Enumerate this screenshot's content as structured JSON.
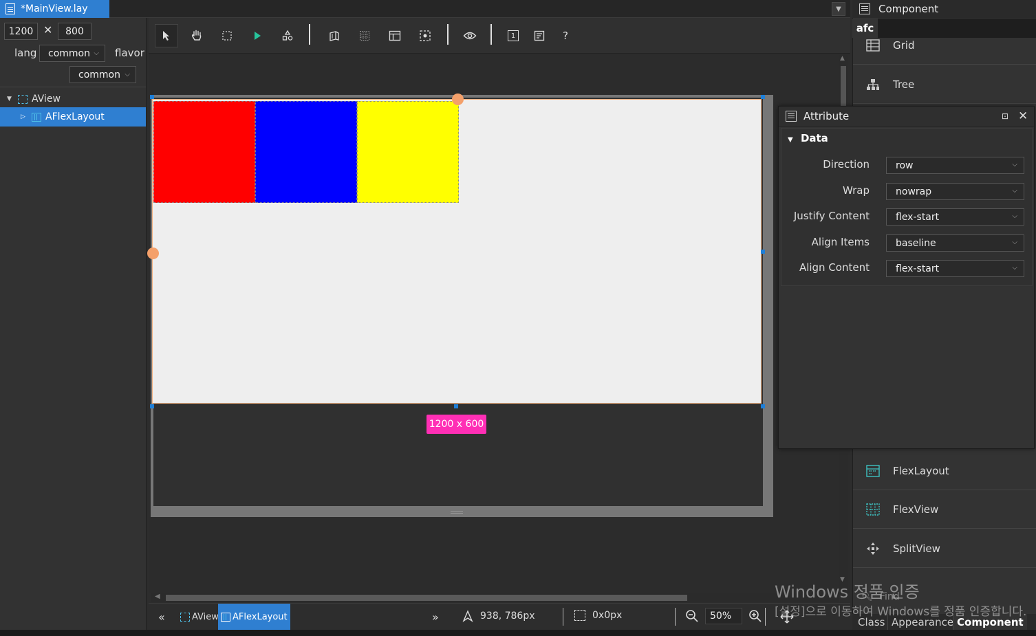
{
  "file_tab": {
    "title": "*MainView.lay"
  },
  "left_panel": {
    "width_value": "1200",
    "times_symbol": "✕",
    "height_value": "800",
    "lang_label": "lang",
    "lang_value": "common",
    "flavor_label": "flavor",
    "flavor_value": "common",
    "tree": [
      {
        "label": "AView",
        "expanded": true,
        "selected": false
      },
      {
        "label": "AFlexLayout",
        "expanded": false,
        "selected": true
      }
    ]
  },
  "toolbar": {
    "help_label": "?",
    "page_number": "1"
  },
  "canvas": {
    "boxes": [
      {
        "color": "#ff0000"
      },
      {
        "color": "#0000ff"
      },
      {
        "color": "#ffff00"
      }
    ],
    "size_badge": "1200 x 600",
    "badge_color": "#ff2fb5"
  },
  "statusbar": {
    "crumbs": [
      "AView",
      "AFlexLayout"
    ],
    "cursor_pos": "938, 786px",
    "selection_size": "0x0px",
    "zoom": "50%"
  },
  "component_panel": {
    "title": "Component",
    "library_tab": "afc",
    "items_top": [
      {
        "label": "Grid",
        "icon": "grid-icon"
      },
      {
        "label": "Tree",
        "icon": "tree-icon"
      }
    ],
    "items_bottom": [
      {
        "label": "FlexLayout",
        "icon": "flexlayout-icon"
      },
      {
        "label": "FlexView",
        "icon": "flexview-icon"
      },
      {
        "label": "SplitView",
        "icon": "splitview-icon"
      }
    ],
    "find_placeholder": "Find",
    "bottom_tabs": [
      "Class",
      "Appearance",
      "Component"
    ],
    "active_bottom_tab": "Component"
  },
  "attribute_panel": {
    "title": "Attribute",
    "section": "Data",
    "rows": [
      {
        "label": "Direction",
        "value": "row"
      },
      {
        "label": "Wrap",
        "value": "nowrap"
      },
      {
        "label": "Justify Content",
        "value": "flex-start"
      },
      {
        "label": "Align Items",
        "value": "baseline"
      },
      {
        "label": "Align Content",
        "value": "flex-start"
      }
    ]
  },
  "watermark": {
    "title": "Windows 정품 인증",
    "subtitle": "[설정]으로 이동하여 Windows를 정품 인증합니다."
  },
  "colors": {
    "accent": "#2f7fd1",
    "panel_bg": "#333333",
    "canvas_bg": "#eeeeee"
  }
}
